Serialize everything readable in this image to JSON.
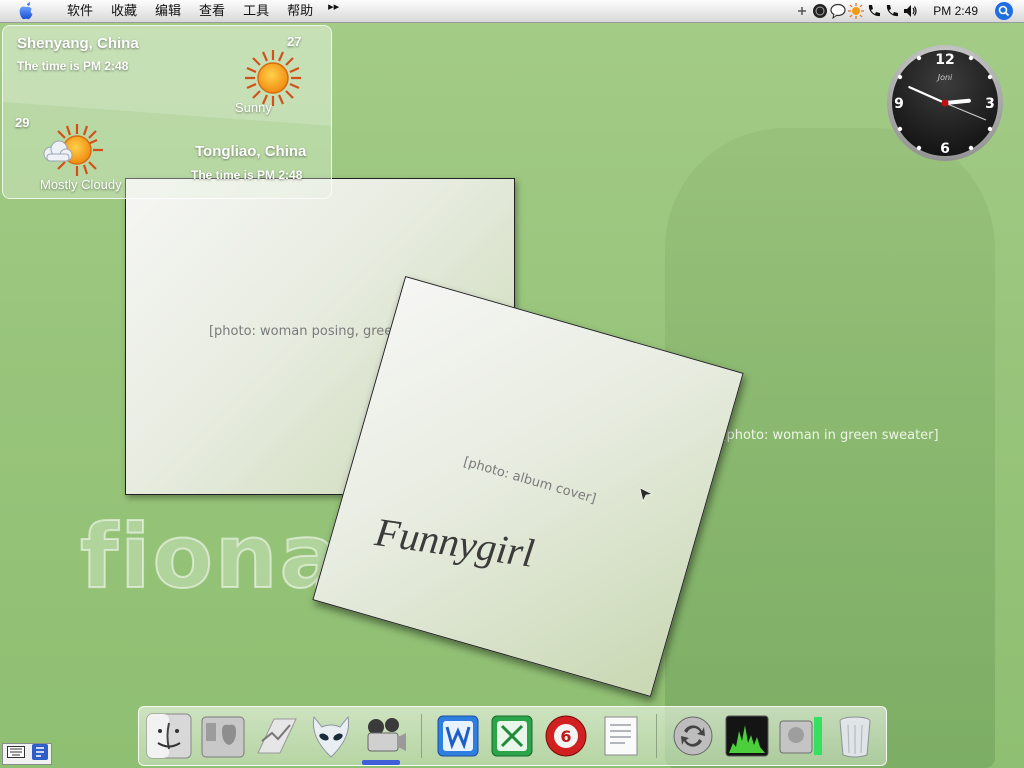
{
  "menubar": {
    "menus": [
      "软件",
      "收藏",
      "编辑",
      "查看",
      "工具",
      "帮助"
    ],
    "more": "▸▸",
    "clock": "PM 2:49",
    "tray_icons": [
      "plus-icon",
      "globe-icon",
      "chat-icon",
      "sun-icon",
      "phone-icon",
      "phone-icon",
      "speaker-icon"
    ]
  },
  "weather": {
    "primary": {
      "city": "Shenyang, China",
      "time": "The time is PM 2:48",
      "temp": "27",
      "condition": "Sunny",
      "icon": "sun-icon"
    },
    "secondary": {
      "city": "Tongliao, China",
      "time": "The time is PM 2:48",
      "temp": "29",
      "condition": "Mostly Cloudy",
      "icon": "partly-cloudy-icon"
    }
  },
  "analog_clock": {
    "brand": "Joni",
    "numerals": [
      "12",
      "3",
      "6",
      "9"
    ],
    "hour": 2,
    "minute": 49
  },
  "photos": {
    "first_label": "[photo: woman posing, green top]",
    "second_label": "[photo: album cover]",
    "second_title": "Funnygirl"
  },
  "wallpaper": {
    "watermark": "fiona",
    "person_label": "[photo: woman in green sweater]"
  },
  "dock": {
    "items": [
      "finder-icon",
      "system-preferences-icon",
      "network-utility-icon",
      "alien-head-icon",
      "video-camera-icon",
      "word-processor-icon",
      "spreadsheet-icon",
      "qq-player-icon",
      "text-edit-icon",
      "sync-icon",
      "activity-monitor-icon",
      "hard-drive-icon",
      "trash-icon"
    ]
  },
  "colors": {
    "wallpaper": "#9cc87f",
    "menubar": "#e9e9e9",
    "spotlight": "#1f6fe0",
    "indicator": "#3e5fd8"
  }
}
